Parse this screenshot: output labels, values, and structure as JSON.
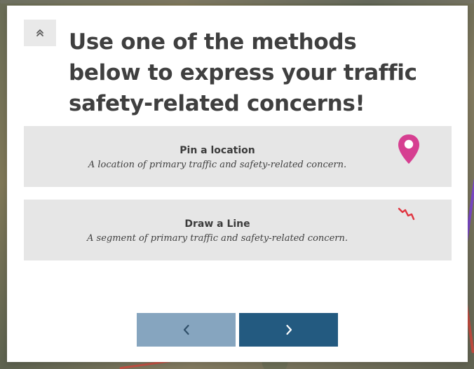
{
  "modal": {
    "title": "Use one of the methods below to express your traffic safety-related concerns!",
    "collapse_button_label": "«"
  },
  "options": [
    {
      "title": "Pin a location",
      "description": "A location of primary traffic and safety-related concern.",
      "icon": "map-pin-icon",
      "icon_color": "#d63f91"
    },
    {
      "title": "Draw a Line",
      "description": "A segment of primary traffic and safety-related concern.",
      "icon": "zigzag-line-icon",
      "icon_color": "#e0343f"
    }
  ],
  "navigation": {
    "previous_icon": "chevron-left-icon",
    "next_icon": "chevron-right-icon",
    "previous_color": "#86a5bf",
    "next_color": "#235a80"
  }
}
